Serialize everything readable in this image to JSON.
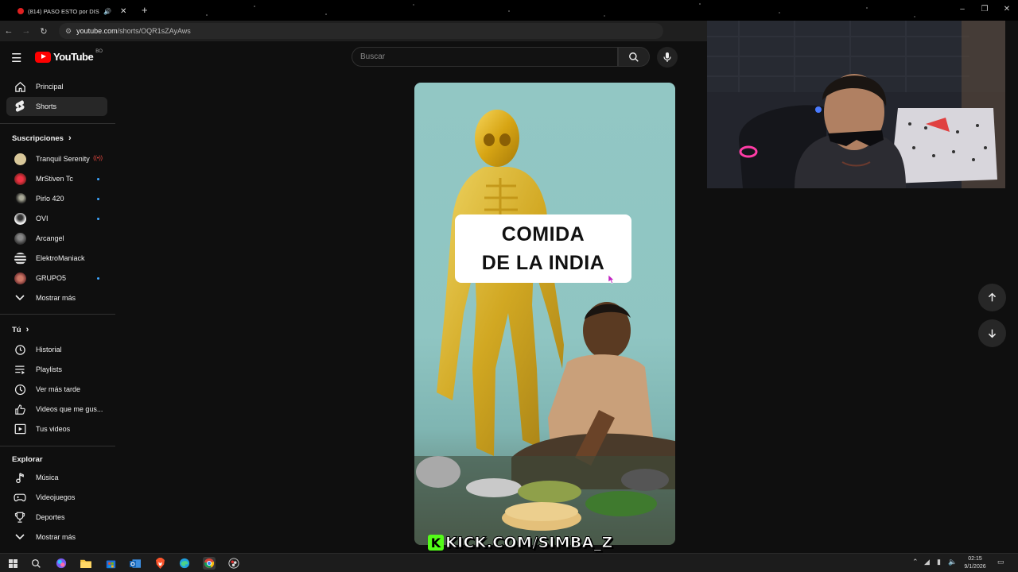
{
  "browser": {
    "tab_title": "(814) PASO ESTO por DISC",
    "new_tab_symbol": "+",
    "url_host": "youtube.com",
    "url_path": "/shorts/OQR1sZAyAws",
    "window_controls": [
      "–",
      "❐",
      "✕"
    ]
  },
  "header": {
    "logo_text": "YouTube",
    "country_code": "BO",
    "search_placeholder": "Buscar"
  },
  "sidebar": {
    "main": [
      {
        "label": "Principal",
        "icon": "home-icon"
      },
      {
        "label": "Shorts",
        "icon": "shorts-icon"
      }
    ],
    "subscriptions_title": "Suscripciones",
    "subscriptions": [
      {
        "label": "Tranquil Serenity",
        "color": "#d9c89a",
        "indicator": "live"
      },
      {
        "label": "MrStiven Tc",
        "color": "#c0392b",
        "indicator": "dot"
      },
      {
        "label": "Pirlo 420",
        "color": "#1a1a1a",
        "indicator": "dot"
      },
      {
        "label": "OVI",
        "color": "#e0e0e0",
        "indicator": "dot"
      },
      {
        "label": "Arcangel",
        "color": "#555555",
        "indicator": ""
      },
      {
        "label": "ElektroManiack",
        "color": "#444444",
        "indicator": ""
      },
      {
        "label": "GRUPO5",
        "color": "#a04030",
        "indicator": "dot"
      }
    ],
    "show_more_1": "Mostrar más",
    "you_title": "Tú",
    "you": [
      {
        "label": "Historial",
        "icon": "history-icon"
      },
      {
        "label": "Playlists",
        "icon": "playlists-icon"
      },
      {
        "label": "Ver más tarde",
        "icon": "watch-later-icon"
      },
      {
        "label": "Videos que me gus...",
        "icon": "liked-icon"
      },
      {
        "label": "Tus videos",
        "icon": "your-videos-icon"
      }
    ],
    "explore_title": "Explorar",
    "explore": [
      {
        "label": "Música",
        "icon": "music-icon"
      },
      {
        "label": "Videojuegos",
        "icon": "gaming-icon"
      },
      {
        "label": "Deportes",
        "icon": "trophy-icon"
      }
    ],
    "show_more_2": "Mostrar más"
  },
  "short": {
    "caption_line1": "COMIDA",
    "caption_line2": "DE LA INDIA"
  },
  "overlay": {
    "kick_letter": "K",
    "kick_text": "KICK.COM/SIMBA_Z"
  },
  "taskbar": {
    "time": "02:15",
    "date": "9/1/2026"
  }
}
